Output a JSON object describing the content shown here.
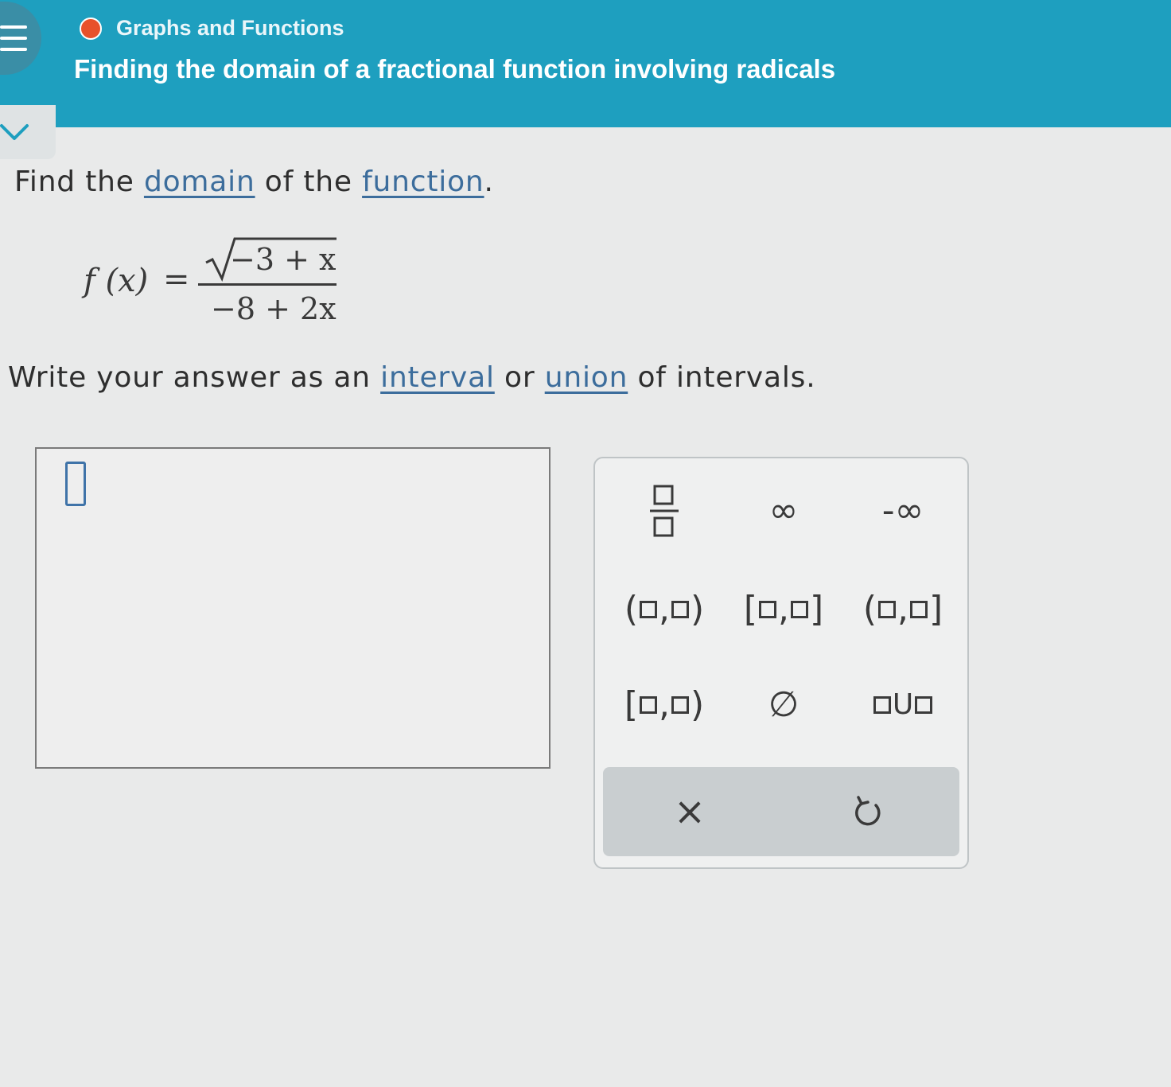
{
  "header": {
    "topic": "Graphs and Functions",
    "lesson": "Finding the domain of a fractional function involving radicals",
    "topic_dot_color": "#e8512a",
    "bar_color": "#1e9fbf"
  },
  "question": {
    "line1_pre": "Find the ",
    "line1_link1": "domain",
    "line1_mid": " of the ",
    "line1_link2": "function",
    "line1_post": ".",
    "formula": {
      "lhs": "f (x)",
      "equals": "=",
      "numerator": "−3 + x",
      "denominator": "−8 + 2x"
    },
    "line2_pre": "Write your answer as an ",
    "line2_link1": "interval",
    "line2_mid": " or ",
    "line2_link2": "union",
    "line2_post": " of intervals."
  },
  "keypad": {
    "infinity": "∞",
    "neg_infinity": "-∞",
    "empty_set": "∅",
    "comma": ",",
    "union": "U",
    "open_paren": "(",
    "close_paren": ")",
    "open_bracket": "[",
    "close_bracket": "]",
    "clear": "×",
    "undo_icon": "undo-icon"
  }
}
